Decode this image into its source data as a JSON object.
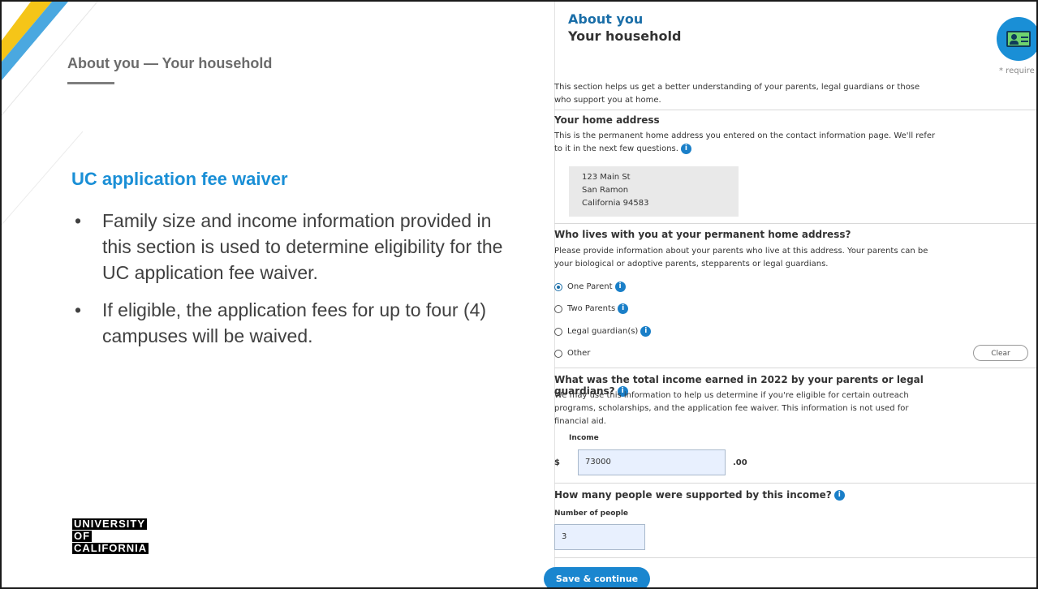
{
  "slide": {
    "title": "About you — Your household",
    "bullets_heading": "UC application fee waiver",
    "bullets": [
      "Family size and income information provided in this section is used to determine eligibility for the UC application fee waiver.",
      "If eligible, the application fees for up to four (4) campuses will be waived."
    ],
    "bullet_symbol": "•",
    "logo_lines": [
      "UNIVERSITY",
      "OF",
      "CALIFORNIA"
    ]
  },
  "form": {
    "section": "About you",
    "subsection": "Your household",
    "required_note": "* require",
    "intro": "This section helps us get a better understanding of your parents, legal guardians or those who support you at home.",
    "home_address": {
      "heading": "Your home address",
      "text": "This is the permanent home address you entered on the contact information page. We'll refer to it in the next few questions.",
      "lines": [
        "123 Main St",
        "San Ramon",
        "California 94583"
      ]
    },
    "who_lives": {
      "question": "Who lives with you at your permanent home address?",
      "help": "Please provide information about your parents who live at this address. Your parents can be your biological or adoptive parents, stepparents or legal guardians.",
      "options": [
        {
          "label": "One Parent",
          "checked": true
        },
        {
          "label": "Two Parents",
          "checked": false
        },
        {
          "label": "Legal guardian(s)",
          "checked": false
        },
        {
          "label": "Other",
          "checked": false
        }
      ],
      "clear_label": "Clear"
    },
    "income": {
      "question": "What was the total income earned in 2022 by your parents or legal guardians?",
      "help": "We may use this information to help us determine if you're eligible for certain outreach programs, scholarships, and the application fee waiver. This information is not used for financial aid.",
      "label": "Income",
      "currency": "$",
      "value": "73000",
      "cents": ".00"
    },
    "people": {
      "question": "How many people were supported by this income?",
      "label": "Number of people",
      "value": "3"
    },
    "info_glyph": "i",
    "save_label": "Save & continue"
  },
  "colors": {
    "accent_blue": "#1a8fd6",
    "deco_yellow": "#f5c518",
    "deco_blue": "#4aa8e0"
  }
}
